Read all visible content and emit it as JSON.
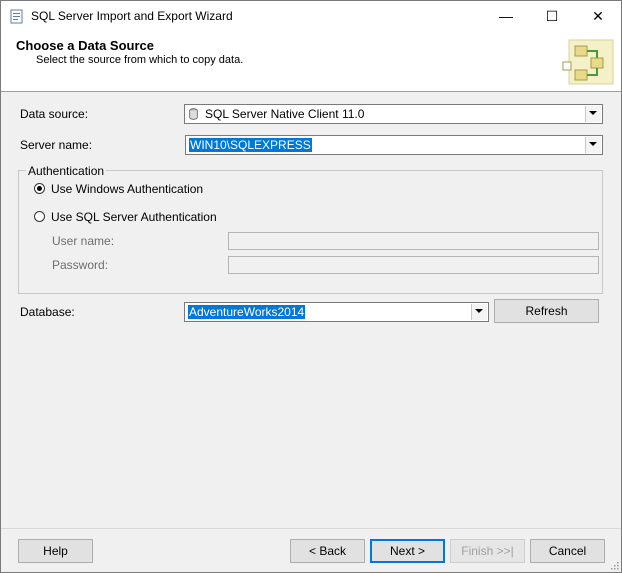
{
  "window": {
    "title": "SQL Server Import and Export Wizard",
    "min_glyph": "—",
    "max_glyph": "☐",
    "close_glyph": "✕"
  },
  "header": {
    "title": "Choose a Data Source",
    "subtitle": "Select the source from which to copy data."
  },
  "form": {
    "data_source_label": "Data source:",
    "data_source_value": "SQL Server Native Client 11.0",
    "server_name_label": "Server name:",
    "server_name_value": "WIN10\\SQLEXPRESS",
    "authentication_legend": "Authentication",
    "windows_auth_label": "Use Windows Authentication",
    "windows_auth_selected": true,
    "sql_auth_label": "Use SQL Server Authentication",
    "sql_auth_selected": false,
    "user_name_label": "User name:",
    "user_name_value": "",
    "password_label": "Password:",
    "password_value": "",
    "database_label": "Database:",
    "database_value": "AdventureWorks2014",
    "refresh_label": "Refresh"
  },
  "footer": {
    "help": "Help",
    "back": "< Back",
    "next": "Next >",
    "finish": "Finish >>|",
    "cancel": "Cancel"
  },
  "colors": {
    "selection": "#0078d7",
    "background": "#f0f0f0"
  }
}
